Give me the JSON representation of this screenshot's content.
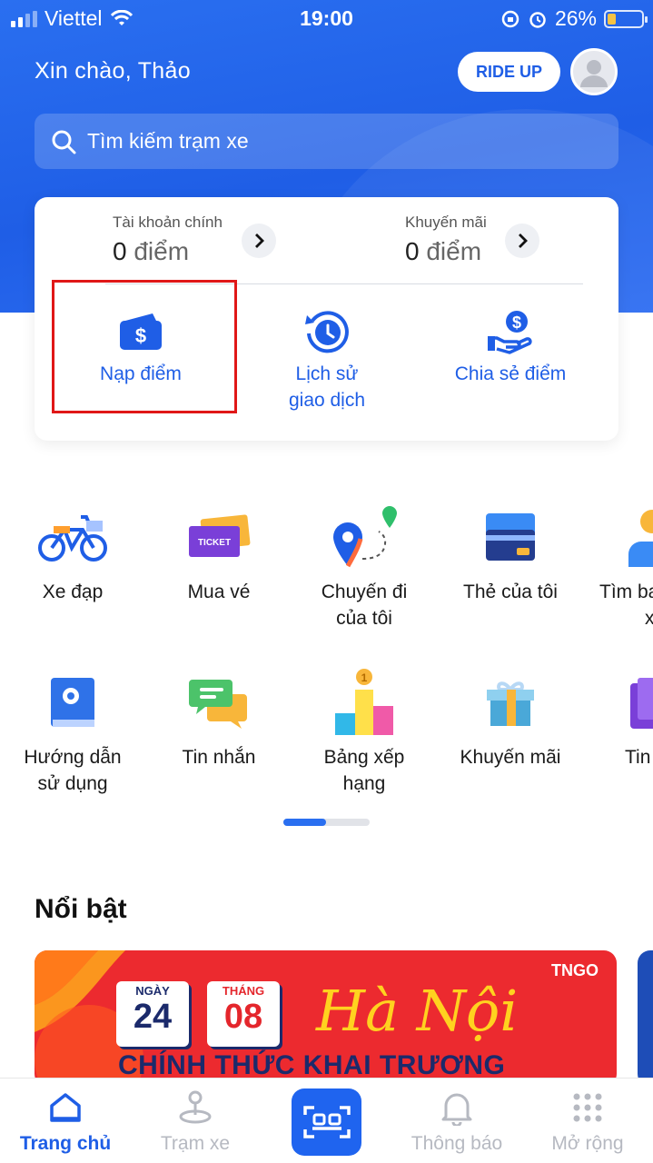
{
  "status_bar": {
    "carrier": "Viettel",
    "time": "19:00",
    "battery": "26%",
    "battery_level": 0.26
  },
  "header": {
    "greeting": "Xin chào, Thảo",
    "ride_up_label": "RIDE UP",
    "search_placeholder": "Tìm kiếm trạm xe"
  },
  "wallet": {
    "main_account": {
      "label": "Tài khoản chính",
      "amount": "0",
      "unit": "điểm"
    },
    "promo_account": {
      "label": "Khuyến mãi",
      "amount": "0",
      "unit": "điểm"
    },
    "actions": [
      {
        "label": "Nạp điểm",
        "icon": "wallet-dollar-icon"
      },
      {
        "label_line1": "Lịch sử",
        "label_line2": "giao dịch",
        "icon": "history-clock-icon"
      },
      {
        "label": "Chia sẻ điểm",
        "icon": "hand-coin-icon"
      }
    ]
  },
  "services": {
    "row1": [
      {
        "line1": "Xe đạp",
        "line2": "",
        "icon": "bicycle-icon"
      },
      {
        "line1": "Mua vé",
        "line2": "",
        "icon": "ticket-icon"
      },
      {
        "line1": "Chuyến đi",
        "line2": "của tôi",
        "icon": "route-pin-icon"
      },
      {
        "line1": "Thẻ của tôi",
        "line2": "",
        "icon": "credit-card-icon"
      },
      {
        "line1": "Tìm ba",
        "line2": "x",
        "icon": "person-icon"
      }
    ],
    "row2": [
      {
        "line1": "Hướng dẫn",
        "line2": "sử dụng",
        "icon": "guide-book-icon"
      },
      {
        "line1": "Tin nhắn",
        "line2": "",
        "icon": "chat-icon"
      },
      {
        "line1": "Bảng xếp",
        "line2": "hạng",
        "icon": "leaderboard-icon"
      },
      {
        "line1": "Khuyến mãi",
        "line2": "",
        "icon": "gift-icon"
      },
      {
        "line1": "Tin",
        "line2": "",
        "icon": "news-icon"
      }
    ]
  },
  "featured": {
    "title": "Nổi bật",
    "banner": {
      "day_label": "NGÀY",
      "day": "24",
      "month_label": "THÁNG",
      "month": "08",
      "city": "Hà Nội",
      "headline": "CHÍNH THỨC KHAI TRƯƠNG",
      "brand": "TNGO"
    }
  },
  "tabs": [
    {
      "label": "Trang chủ",
      "icon": "home-icon",
      "active": true
    },
    {
      "label": "Trạm xe",
      "icon": "station-pin-icon",
      "active": false
    },
    {
      "label": "",
      "icon": "scan-icon",
      "active": false
    },
    {
      "label": "Thông báo",
      "icon": "bell-icon",
      "active": false
    },
    {
      "label": "Mở rộng",
      "icon": "grid-dots-icon",
      "active": false
    }
  ],
  "colors": {
    "primary": "#1f5ee6",
    "highlight_box": "#e01717",
    "tab_inactive": "#b6b9c1"
  }
}
